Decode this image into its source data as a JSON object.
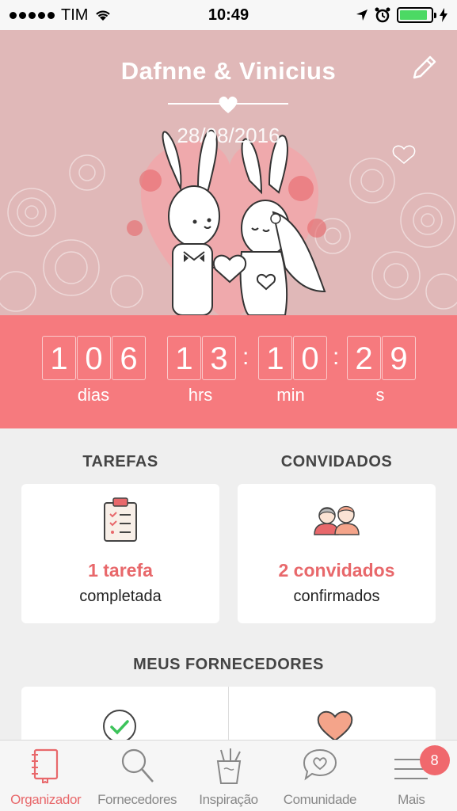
{
  "status_bar": {
    "carrier": "TIM",
    "time": "10:49",
    "battery_level": 0.9
  },
  "hero": {
    "couple_names": "Dafnne & Vinicius",
    "date": "28/08/2016",
    "edit_icon": "pencil-icon",
    "heart_icon": "heart-icon"
  },
  "countdown": {
    "days_digits": [
      "1",
      "0",
      "6"
    ],
    "hours_digits": [
      "1",
      "3"
    ],
    "minutes_digits": [
      "1",
      "0"
    ],
    "seconds_digits": [
      "2",
      "9"
    ],
    "days_label": "dias",
    "hours_label": "hrs",
    "minutes_label": "min",
    "seconds_label": "s",
    "separator": ":"
  },
  "tasks": {
    "title": "TAREFAS",
    "main": "1 tarefa",
    "sub": "completada",
    "icon": "clipboard-icon"
  },
  "guests": {
    "title": "CONVIDADOS",
    "main": "2 convidados",
    "sub": "confirmados",
    "icon": "couple-icon"
  },
  "vendors": {
    "title": "MEUS FORNECEDORES",
    "left_icon": "check-circle-icon",
    "right_icon": "heart-icon"
  },
  "tabbar": {
    "items": [
      {
        "label": "Organizador",
        "icon": "notebook-icon",
        "active": true
      },
      {
        "label": "Fornecedores",
        "icon": "search-icon",
        "active": false
      },
      {
        "label": "Inspiração",
        "icon": "pencil-cup-icon",
        "active": false
      },
      {
        "label": "Comunidade",
        "icon": "chat-heart-icon",
        "active": false
      },
      {
        "label": "Mais",
        "icon": "menu-icon",
        "active": false,
        "badge": "8"
      }
    ]
  },
  "colors": {
    "accent": "#f67a7e",
    "accent_text": "#e8686b",
    "hero_bg": "#e0b8b8",
    "page_bg": "#efefef"
  }
}
